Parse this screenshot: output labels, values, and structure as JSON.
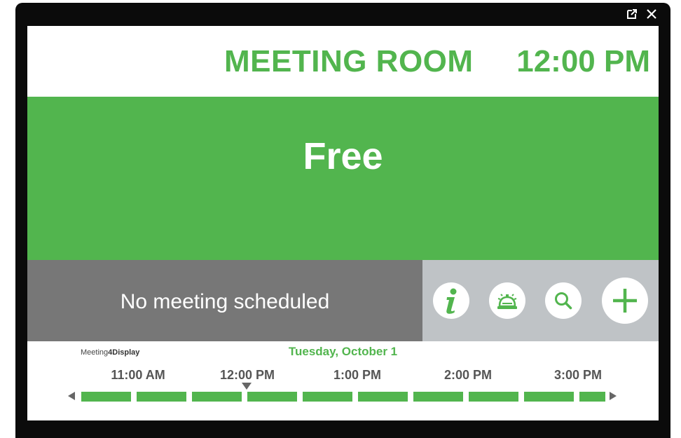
{
  "header": {
    "room_name": "MEETING ROOM",
    "clock": "12:00 PM"
  },
  "status": {
    "label": "Free"
  },
  "meeting": {
    "current": "No meeting scheduled"
  },
  "actions": [
    {
      "name": "info-icon"
    },
    {
      "name": "bell-icon"
    },
    {
      "name": "search-icon"
    },
    {
      "name": "plus-icon"
    }
  ],
  "timeline": {
    "brand_prefix": "Meeting",
    "brand_bold": "4Display",
    "date": "Tuesday, October 1",
    "times": [
      "11:00 AM",
      "12:00 PM",
      "1:00 PM",
      "2:00 PM",
      "3:00 PM"
    ],
    "slots": [
      {
        "status": "free"
      },
      {
        "status": "free"
      },
      {
        "status": "free"
      },
      {
        "status": "free"
      },
      {
        "status": "free"
      },
      {
        "status": "free"
      },
      {
        "status": "free"
      },
      {
        "status": "free"
      },
      {
        "status": "free"
      },
      {
        "status": "free"
      }
    ]
  },
  "colors": {
    "accent": "#52b54e",
    "meeting_panel": "#777777",
    "actions_panel": "#bfc3c6"
  }
}
